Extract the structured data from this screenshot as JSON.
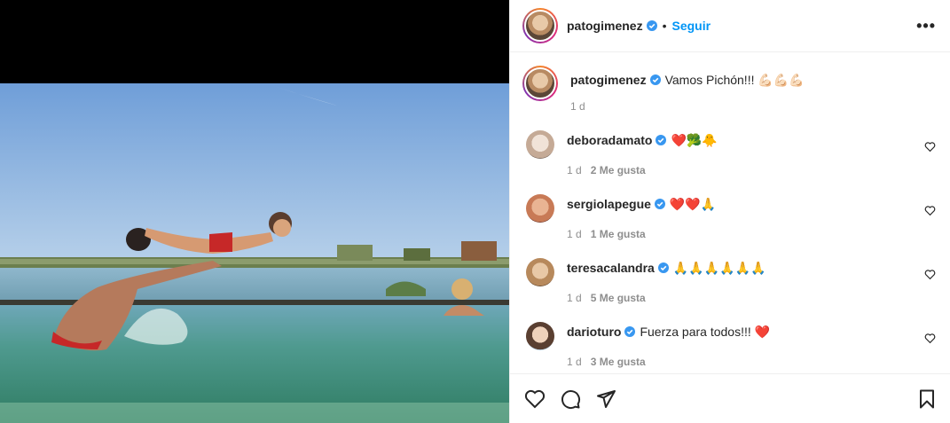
{
  "post": {
    "author": "patogimenez",
    "follow_label": "Seguir",
    "dot": "•",
    "more_label": "•••"
  },
  "caption": {
    "username": "patogimenez",
    "text": "Vamos Pichón!!! 💪🏻💪🏻💪🏻",
    "time": "1 d"
  },
  "comments": [
    {
      "username": "deboradamato",
      "text": "❤️🥦🐥",
      "time": "1 d",
      "likes": "2 Me gusta"
    },
    {
      "username": "sergiolapegue",
      "text": "❤️❤️🙏",
      "time": "1 d",
      "likes": "1 Me gusta"
    },
    {
      "username": "teresacalandra",
      "text": "🙏🙏🙏🙏🙏🙏",
      "time": "1 d",
      "likes": "5 Me gusta"
    },
    {
      "username": "darioturo",
      "text": "Fuerza para todos!!! ❤️",
      "time": "1 d",
      "likes": "3 Me gusta"
    }
  ],
  "colors": {
    "accent": "#0095f6",
    "verified": "#3897f0",
    "muted": "#8e8e8e"
  }
}
